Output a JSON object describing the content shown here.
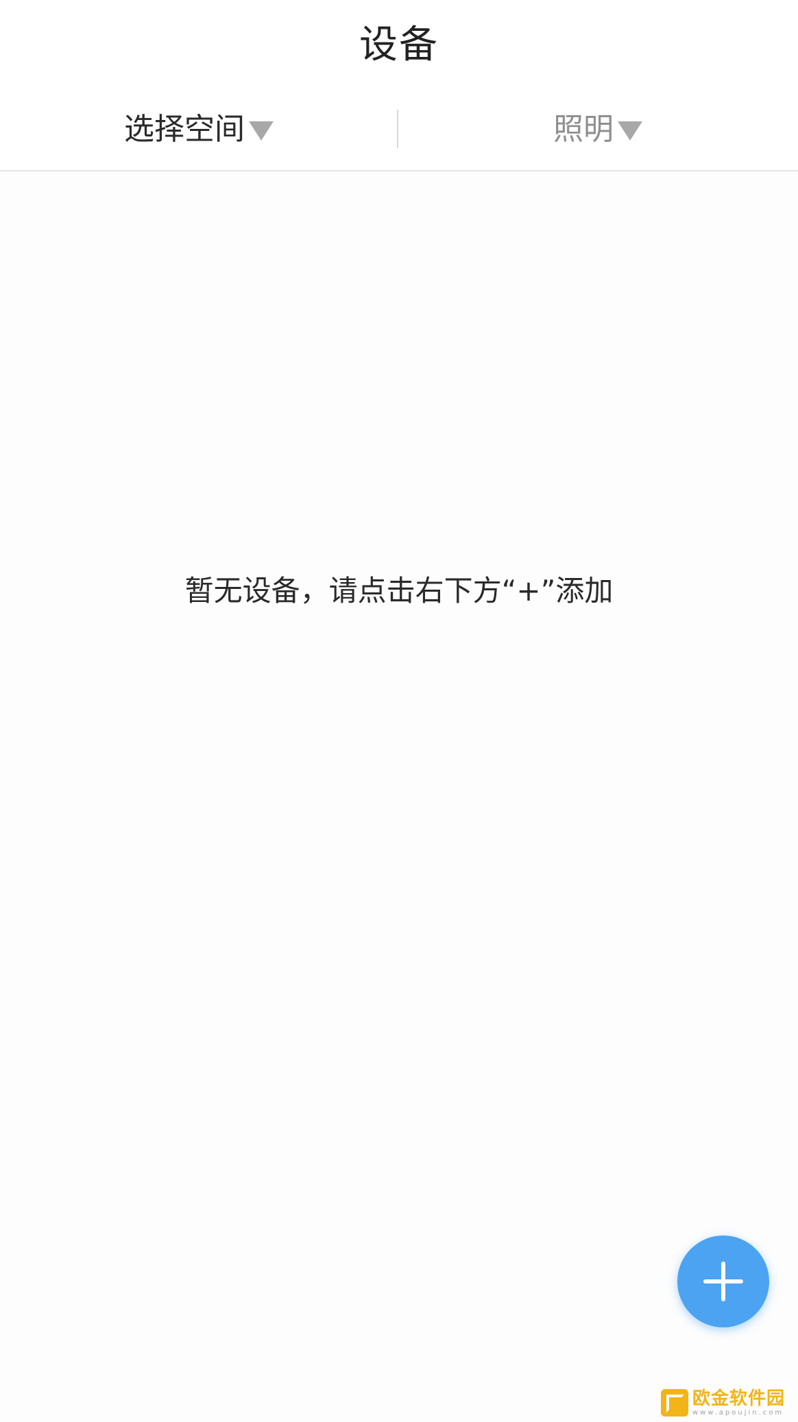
{
  "header": {
    "title": "设备"
  },
  "filters": {
    "space": {
      "label": "选择空间",
      "icon": "caret-down-icon"
    },
    "category": {
      "label": "照明",
      "icon": "caret-down-icon"
    }
  },
  "empty_state": {
    "message": "暂无设备，请点击右下方“+”添加"
  },
  "fab": {
    "icon": "plus-icon",
    "color": "#4ba3f1"
  },
  "watermark": {
    "text": "欧金软件园",
    "url": "www.apoujin.com",
    "color": "#f2b418"
  }
}
